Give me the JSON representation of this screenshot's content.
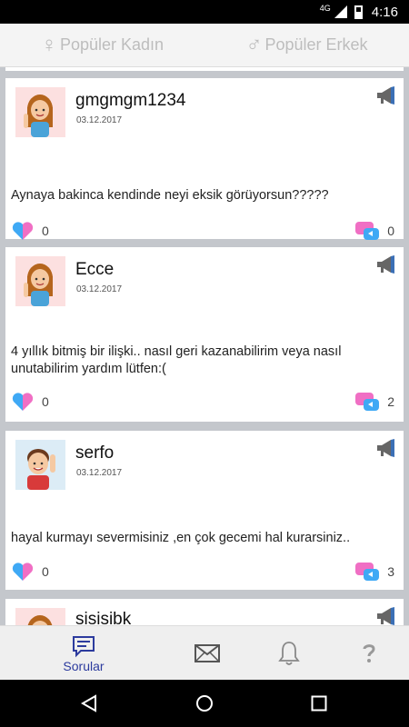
{
  "status": {
    "network": "4G",
    "time": "4:16"
  },
  "filters": [
    {
      "symbol": "♀",
      "label": "Popüler Kadın"
    },
    {
      "symbol": "♂",
      "label": "Popüler Erkek"
    }
  ],
  "posts": [
    {
      "username": "gmgmgm1234",
      "date": "03.12.2017",
      "avatar": "girl-avatar",
      "text": "Aynaya bakinca kendinde neyi eksik görüyorsun?????",
      "likes": "0",
      "comments": "0"
    },
    {
      "username": "Ecce",
      "date": "03.12.2017",
      "avatar": "girl-avatar",
      "text": "4 yıllık bitmiş bir ilişki.. nasıl geri kazanabilirim veya nasıl unutabilirim yardım lütfen:(",
      "likes": "0",
      "comments": "2"
    },
    {
      "username": "serfo",
      "date": "03.12.2017",
      "avatar": "boy-avatar",
      "text": "hayal kurmayı severmisiniz ,en çok gecemi hal kurarsiniz..",
      "likes": "0",
      "comments": "3"
    },
    {
      "username": "sisisibk",
      "avatar": "girl-avatar"
    }
  ],
  "bottom_nav": {
    "items": [
      {
        "icon": "questions-chat-icon",
        "label": "Sorular",
        "active": true
      },
      {
        "icon": "envelope-icon"
      },
      {
        "icon": "bell-icon"
      },
      {
        "icon": "help-question-icon"
      }
    ]
  },
  "colors": {
    "accent": "#2c3b9e",
    "like_pink": "#f06fc4",
    "like_blue": "#3fa9f5",
    "feed_bg": "#c4c7cc"
  }
}
